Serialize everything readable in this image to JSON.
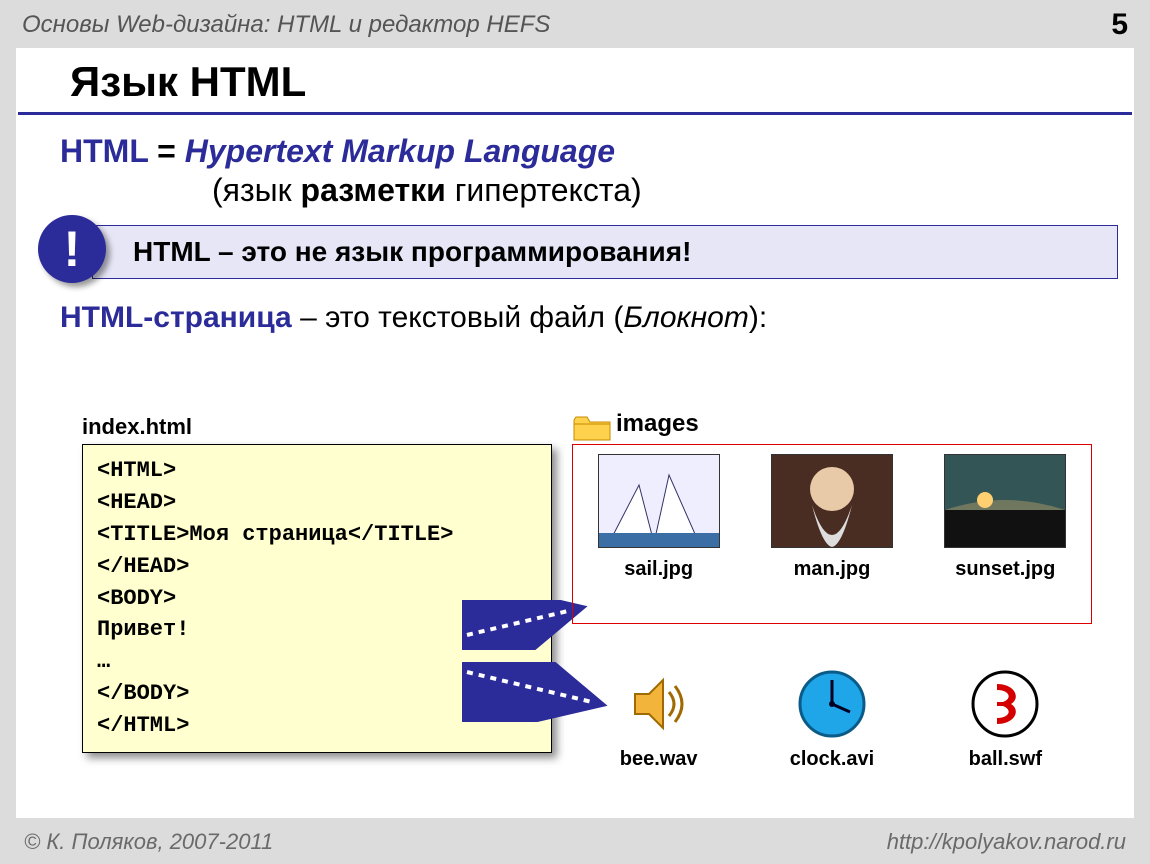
{
  "header": {
    "breadcrumb": "Основы Web-дизайна: HTML и редактор HEFS",
    "page_number": "5"
  },
  "title": "Язык HTML",
  "definition": {
    "lhs": "HTML",
    "eq": " = ",
    "rhs": "Hypertext Markup Language",
    "translation_prefix": "(язык ",
    "translation_bold": "разметки",
    "translation_suffix": " гипертекста)"
  },
  "callout": {
    "mark": "!",
    "text": "HTML – это не язык программирования!"
  },
  "line3": {
    "kw": "HTML-страница",
    "middle": " – это текстовый файл (",
    "it": "Блокнот",
    "end": "):"
  },
  "code": {
    "filename": "index.html",
    "lines": "<HTML>\n<HEAD>\n<TITLE>Моя страница</TITLE>\n</HEAD>\n<BODY>\nПривет!\n…\n</BODY>\n</HTML>"
  },
  "folder": {
    "name": "images"
  },
  "thumbs": [
    {
      "caption": "sail.jpg"
    },
    {
      "caption": "man.jpg"
    },
    {
      "caption": "sunset.jpg"
    }
  ],
  "media": [
    {
      "caption": "bee.wav"
    },
    {
      "caption": "clock.avi"
    },
    {
      "caption": "ball.swf"
    }
  ],
  "footer": {
    "left": "© К. Поляков, 2007-2011",
    "right": "http://kpolyakov.narod.ru"
  }
}
